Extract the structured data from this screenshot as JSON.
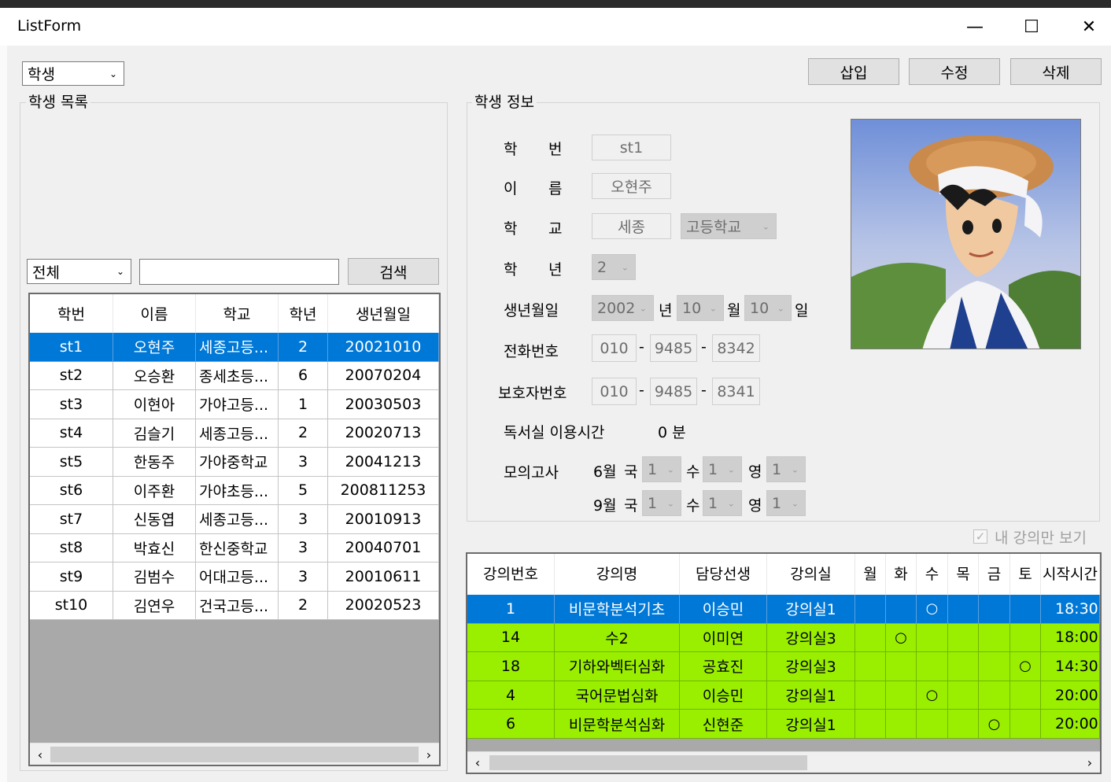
{
  "window": {
    "title": "ListForm",
    "min_glyph": "—",
    "max_glyph": "☐",
    "close_glyph": "✕"
  },
  "toolbar": {
    "category": "학생",
    "insert": "삽입",
    "edit": "수정",
    "delete": "삭제"
  },
  "student_list": {
    "group_title": "학생 목록",
    "filter": "전체",
    "search_value": "",
    "search_button": "검색",
    "columns": [
      "학번",
      "이름",
      "학교",
      "학년",
      "생년월일"
    ],
    "rows": [
      [
        "st1",
        "오현주",
        "세종고등...",
        "2",
        "20021010"
      ],
      [
        "st2",
        "오승환",
        "종세초등...",
        "6",
        "20070204"
      ],
      [
        "st3",
        "이현아",
        "가야고등...",
        "1",
        "20030503"
      ],
      [
        "st4",
        "김슬기",
        "세종고등...",
        "2",
        "20020713"
      ],
      [
        "st5",
        "한동주",
        "가야중학교",
        "3",
        "20041213"
      ],
      [
        "st6",
        "이주환",
        "가야초등...",
        "5",
        "200811253"
      ],
      [
        "st7",
        "신동엽",
        "세종고등...",
        "3",
        "20010913"
      ],
      [
        "st8",
        "박효신",
        "한신중학교",
        "3",
        "20040701"
      ],
      [
        "st9",
        "김범수",
        "어대고등...",
        "3",
        "20010611"
      ],
      [
        "st10",
        "김연우",
        "건국고등...",
        "2",
        "20020523"
      ]
    ],
    "selected_row": 0
  },
  "student_info": {
    "group_title": "학생 정보",
    "id_label": [
      "학",
      "번"
    ],
    "id_value": "st1",
    "name_label": [
      "이",
      "름"
    ],
    "name_value": "오현주",
    "school_label": [
      "학",
      "교"
    ],
    "school_value": "세종",
    "school_type": "고등학교",
    "grade_label": [
      "학",
      "년"
    ],
    "grade_value": "2",
    "birth_label": "생년월일",
    "birth_year": "2002",
    "year_unit": "년",
    "birth_month": "10",
    "month_unit": "월",
    "birth_day": "10",
    "day_unit": "일",
    "phone_label": "전화번호",
    "phone": [
      "010",
      "9485",
      "8342"
    ],
    "guardian_label": "보호자번호",
    "guardian_phone": [
      "010",
      "9485",
      "8341"
    ],
    "dash": "-",
    "study_room_label": "독서실 이용시간",
    "study_room_value": "0 분",
    "mock_exam_label": "모의고사",
    "mock_exam": [
      {
        "month": "6월",
        "kor_label": "국",
        "kor": "1",
        "math_label": "수",
        "math": "1",
        "eng_label": "영",
        "eng": "1"
      },
      {
        "month": "9월",
        "kor_label": "국",
        "kor": "1",
        "math_label": "수",
        "math": "1",
        "eng_label": "영",
        "eng": "1"
      }
    ]
  },
  "my_lectures_only": {
    "label": "내 강의만 보기",
    "checked": true
  },
  "lectures": {
    "columns": [
      "강의번호",
      "강의명",
      "담당선생",
      "강의실",
      "월",
      "화",
      "수",
      "목",
      "금",
      "토",
      "시작시간"
    ],
    "rows": [
      {
        "no": "1",
        "name": "비문학분석기초",
        "teacher": "이승민",
        "room": "강의실1",
        "days": [
          "",
          "",
          "○",
          "",
          "",
          ""
        ],
        "start": "18:30"
      },
      {
        "no": "14",
        "name": "수2",
        "teacher": "이미연",
        "room": "강의실3",
        "days": [
          "",
          "○",
          "",
          "",
          "",
          ""
        ],
        "start": "18:00"
      },
      {
        "no": "18",
        "name": "기하와벡터심화",
        "teacher": "공효진",
        "room": "강의실3",
        "days": [
          "",
          "",
          "",
          "",
          "",
          "○"
        ],
        "start": "14:30"
      },
      {
        "no": "4",
        "name": "국어문법심화",
        "teacher": "이승민",
        "room": "강의실1",
        "days": [
          "",
          "",
          "○",
          "",
          "",
          ""
        ],
        "start": "20:00"
      },
      {
        "no": "6",
        "name": "비문학분석심화",
        "teacher": "신현준",
        "room": "강의실1",
        "days": [
          "",
          "",
          "",
          "",
          "○",
          ""
        ],
        "start": "20:00"
      }
    ],
    "selected_row": 0
  },
  "colors": {
    "selected": "#0078d7",
    "lecture_row": "#9aef00",
    "grid_bg": "#a9a9a9"
  }
}
